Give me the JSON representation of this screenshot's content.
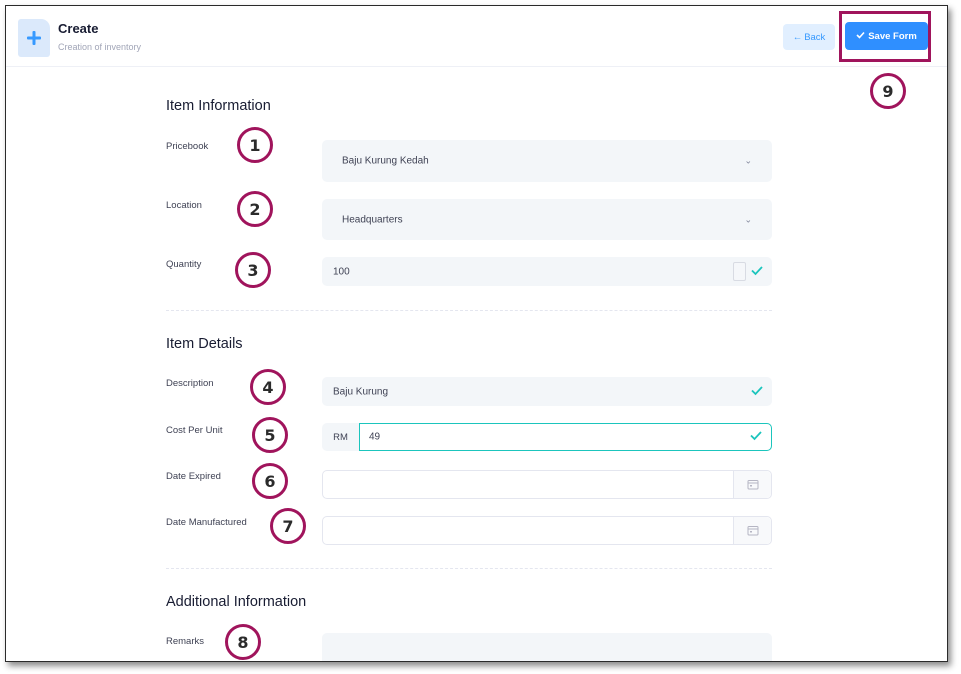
{
  "header": {
    "title": "Create",
    "subtitle": "Creation of inventory",
    "back_label": "Back",
    "save_label": "Save Form",
    "icon": "plus-icon"
  },
  "sections": {
    "item_information": "Item Information",
    "item_details": "Item Details",
    "additional_information": "Additional Information"
  },
  "fields": {
    "pricebook": {
      "label": "Pricebook",
      "value": "Baju Kurung Kedah"
    },
    "location": {
      "label": "Location",
      "value": "Headquarters"
    },
    "quantity": {
      "label": "Quantity",
      "value": "100"
    },
    "description": {
      "label": "Description",
      "value": "Baju Kurung"
    },
    "cost_per_unit": {
      "label": "Cost Per Unit",
      "currency": "RM",
      "value": "49"
    },
    "date_expired": {
      "label": "Date Expired",
      "value": ""
    },
    "date_manufactured": {
      "label": "Date Manufactured",
      "value": ""
    },
    "remarks": {
      "label": "Remarks",
      "value": ""
    }
  },
  "annotations": [
    "1",
    "2",
    "3",
    "4",
    "5",
    "6",
    "7",
    "8",
    "9"
  ],
  "colors": {
    "accent": "#2f8fff",
    "valid": "#1bc5bd",
    "annotation": "#a0145c",
    "field_bg": "#f3f6f9"
  }
}
